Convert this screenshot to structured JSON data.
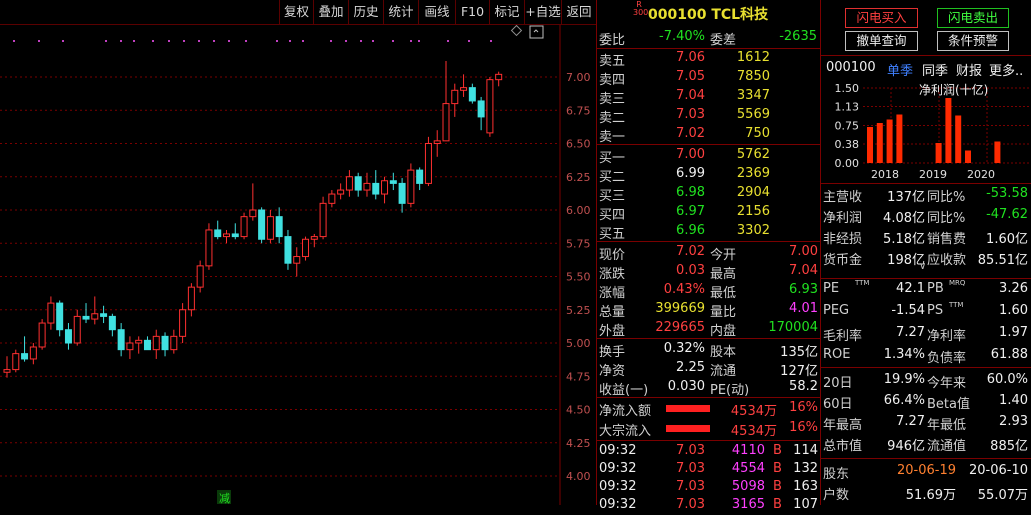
{
  "toolbar": {
    "buttons": [
      "复权",
      "叠加",
      "历史",
      "统计",
      "画线",
      "F10",
      "标记",
      "+自选",
      "返回"
    ]
  },
  "chart": {
    "y_ticks": [
      "7.00",
      "6.75",
      "6.50",
      "6.25",
      "6.00",
      "5.75",
      "5.50",
      "5.25",
      "5.00",
      "4.75",
      "4.50",
      "4.25",
      "4.00"
    ],
    "marker": "减",
    "colors": {
      "up": "#ff3030",
      "down": "#40e0e0",
      "grid": "#7a0000",
      "label": "#c05050"
    },
    "candles": [
      [
        4.78,
        4.9,
        4.74,
        4.8
      ],
      [
        4.8,
        4.95,
        4.78,
        4.92
      ],
      [
        4.92,
        5.05,
        4.86,
        4.88
      ],
      [
        4.88,
        5.0,
        4.84,
        4.97
      ],
      [
        4.97,
        5.18,
        4.95,
        5.15
      ],
      [
        5.15,
        5.35,
        5.1,
        5.3
      ],
      [
        5.3,
        5.32,
        5.05,
        5.1
      ],
      [
        5.1,
        5.15,
        4.95,
        5.0
      ],
      [
        5.0,
        5.25,
        4.98,
        5.2
      ],
      [
        5.2,
        5.3,
        5.15,
        5.18
      ],
      [
        5.18,
        5.35,
        5.14,
        5.22
      ],
      [
        5.22,
        5.28,
        5.15,
        5.2
      ],
      [
        5.2,
        5.22,
        5.05,
        5.1
      ],
      [
        5.1,
        5.15,
        4.9,
        4.95
      ],
      [
        4.95,
        5.05,
        4.88,
        5.0
      ],
      [
        5.0,
        5.05,
        4.92,
        5.02
      ],
      [
        5.02,
        5.05,
        4.95,
        4.95
      ],
      [
        4.95,
        5.1,
        4.88,
        5.05
      ],
      [
        5.05,
        5.08,
        4.9,
        4.95
      ],
      [
        4.95,
        5.1,
        4.92,
        5.05
      ],
      [
        5.05,
        5.3,
        5.0,
        5.25
      ],
      [
        5.25,
        5.45,
        5.2,
        5.42
      ],
      [
        5.42,
        5.62,
        5.38,
        5.58
      ],
      [
        5.58,
        5.9,
        5.55,
        5.85
      ],
      [
        5.85,
        5.92,
        5.78,
        5.8
      ],
      [
        5.8,
        5.85,
        5.75,
        5.82
      ],
      [
        5.82,
        5.9,
        5.78,
        5.8
      ],
      [
        5.8,
        5.98,
        5.78,
        5.95
      ],
      [
        5.95,
        6.2,
        5.92,
        6.0
      ],
      [
        6.0,
        6.02,
        5.75,
        5.78
      ],
      [
        5.78,
        6.0,
        5.75,
        5.95
      ],
      [
        5.95,
        6.02,
        5.75,
        5.8
      ],
      [
        5.8,
        5.85,
        5.55,
        5.6
      ],
      [
        5.6,
        5.72,
        5.5,
        5.65
      ],
      [
        5.65,
        5.8,
        5.62,
        5.78
      ],
      [
        5.78,
        5.82,
        5.72,
        5.8
      ],
      [
        5.8,
        6.1,
        5.78,
        6.05
      ],
      [
        6.05,
        6.15,
        6.02,
        6.12
      ],
      [
        6.12,
        6.2,
        6.08,
        6.15
      ],
      [
        6.15,
        6.3,
        6.1,
        6.25
      ],
      [
        6.25,
        6.28,
        6.1,
        6.15
      ],
      [
        6.15,
        6.28,
        6.1,
        6.2
      ],
      [
        6.2,
        6.3,
        6.08,
        6.12
      ],
      [
        6.12,
        6.25,
        6.05,
        6.22
      ],
      [
        6.22,
        6.28,
        6.15,
        6.2
      ],
      [
        6.2,
        6.24,
        5.98,
        6.05
      ],
      [
        6.05,
        6.35,
        6.02,
        6.3
      ],
      [
        6.3,
        6.32,
        6.15,
        6.2
      ],
      [
        6.2,
        6.55,
        6.18,
        6.5
      ],
      [
        6.5,
        6.6,
        6.4,
        6.52
      ],
      [
        6.52,
        7.12,
        6.7,
        6.8
      ],
      [
        6.8,
        6.95,
        6.7,
        6.9
      ],
      [
        6.9,
        7.02,
        6.85,
        6.92
      ],
      [
        6.92,
        6.95,
        6.8,
        6.82
      ],
      [
        6.82,
        6.85,
        6.6,
        6.7
      ],
      [
        6.58,
        7.0,
        6.55,
        6.98
      ],
      [
        6.98,
        7.04,
        6.93,
        7.02
      ]
    ]
  },
  "quote": {
    "badge_r": "R",
    "badge_num": "300",
    "title": "000100 TCL科技",
    "weibi_label": "委比",
    "weibi_value": "-7.40%",
    "weicha_label": "委差",
    "weicha_value": "-2635",
    "sells": [
      {
        "label": "卖五",
        "price": "7.06",
        "vol": "1612"
      },
      {
        "label": "卖四",
        "price": "7.05",
        "vol": "7850"
      },
      {
        "label": "卖三",
        "price": "7.04",
        "vol": "3347"
      },
      {
        "label": "卖二",
        "price": "7.03",
        "vol": "5569"
      },
      {
        "label": "卖一",
        "price": "7.02",
        "vol": "750"
      }
    ],
    "buys": [
      {
        "label": "买一",
        "price": "7.00",
        "vol": "5762"
      },
      {
        "label": "买二",
        "price": "6.99",
        "vol": "2369"
      },
      {
        "label": "买三",
        "price": "6.98",
        "vol": "2904"
      },
      {
        "label": "买四",
        "price": "6.97",
        "vol": "2156"
      },
      {
        "label": "买五",
        "price": "6.96",
        "vol": "3302"
      }
    ],
    "stats": [
      {
        "l1": "现价",
        "v1": "7.02",
        "l2": "今开",
        "v2": "7.00"
      },
      {
        "l1": "涨跌",
        "v1": "0.03",
        "l2": "最高",
        "v2": "7.04"
      },
      {
        "l1": "涨幅",
        "v1": "0.43%",
        "l2": "最低",
        "v2": "6.93"
      },
      {
        "l1": "总量",
        "v1": "399669",
        "l2": "量比",
        "v2": "4.01"
      },
      {
        "l1": "外盘",
        "v1": "229665",
        "l2": "内盘",
        "v2": "170004"
      }
    ],
    "stats2": [
      {
        "l1": "换手",
        "v1": "0.32%",
        "l2": "股本",
        "v2": "135亿"
      },
      {
        "l1": "净资",
        "v1": "2.25",
        "l2": "流通",
        "v2": "127亿"
      },
      {
        "l1": "收益(一)",
        "v1": "0.030",
        "l2": "PE(动)",
        "v2": "58.2"
      }
    ],
    "flows": [
      {
        "label": "净流入额",
        "value": "4534万",
        "pct": "16%"
      },
      {
        "label": "大宗流入",
        "value": "4534万",
        "pct": "16%"
      }
    ],
    "ticks": [
      {
        "time": "09:32",
        "price": "7.03",
        "vol": "4110",
        "side": "B",
        "n": "114"
      },
      {
        "time": "09:32",
        "price": "7.03",
        "vol": "4554",
        "side": "B",
        "n": "132"
      },
      {
        "time": "09:32",
        "price": "7.03",
        "vol": "5098",
        "side": "B",
        "n": "163"
      },
      {
        "time": "09:32",
        "price": "7.03",
        "vol": "3165",
        "side": "B",
        "n": "107"
      }
    ]
  },
  "right": {
    "buttons": {
      "flash_buy": "闪电买入",
      "flash_sell": "闪电卖出",
      "cancel": "撤单查询",
      "cond": "条件预警"
    },
    "tabs": {
      "code": "000100",
      "t1": "单季",
      "t2": "同季",
      "t3": "财报",
      "t4": "更多.."
    },
    "fin_title": "净利润(十亿)",
    "fin_y": [
      "1.50",
      "1.13",
      "0.75",
      "0.38",
      "0.00"
    ],
    "fin_years": [
      "2018",
      "2019",
      "2020"
    ],
    "fin_values": [
      0.72,
      0.8,
      0.87,
      0.97,
      0.0,
      0.0,
      0.0,
      0.4,
      1.3,
      0.95,
      0.25,
      0.0,
      0.0,
      0.43
    ],
    "rows": [
      {
        "l1": "主营收",
        "v1": "137亿",
        "l2": "同比%",
        "v2": "-53.58"
      },
      {
        "l1": "净利润",
        "v1": "4.08亿",
        "l2": "同比%",
        "v2": "-47.62"
      },
      {
        "l1": "非经损",
        "v1": "5.18亿",
        "l2": "销售费",
        "v2": "1.60亿"
      },
      {
        "l1": "货币金",
        "v1": "198亿",
        "l2": "应收款",
        "v2": "85.51亿"
      }
    ],
    "rows2": [
      {
        "l1": "PE",
        "s1": "TTM",
        "v1": "42.1",
        "l2": "PB",
        "s2": "MRQ",
        "v2": "3.26"
      },
      {
        "l1": "PEG",
        "s1": "",
        "v1": "-1.54",
        "l2": "PS",
        "s2": "TTM",
        "v2": "1.60"
      },
      {
        "l1": "毛利率",
        "s1": "",
        "v1": "7.27",
        "l2": "净利率",
        "s2": "",
        "v2": "1.97"
      },
      {
        "l1": "ROE",
        "s1": "",
        "v1": "1.34%",
        "l2": "负债率",
        "s2": "",
        "v2": "61.88"
      }
    ],
    "rows3": [
      {
        "l1": "20日",
        "v1": "19.9%",
        "l2": "今年来",
        "v2": "60.0%"
      },
      {
        "l1": "60日",
        "v1": "66.4%",
        "l2": "Beta值",
        "v2": "1.40"
      },
      {
        "l1": "年最高",
        "v1": "7.27",
        "l2": "年最低",
        "v2": "2.93"
      },
      {
        "l1": "总市值",
        "v1": "946亿",
        "l2": "流通值",
        "v2": "885亿"
      }
    ],
    "holders": {
      "l1": "股东",
      "d1": "20-06-19",
      "d2": "20-06-10",
      "l2": "户数",
      "h1": "51.69万",
      "h2": "55.07万"
    }
  }
}
